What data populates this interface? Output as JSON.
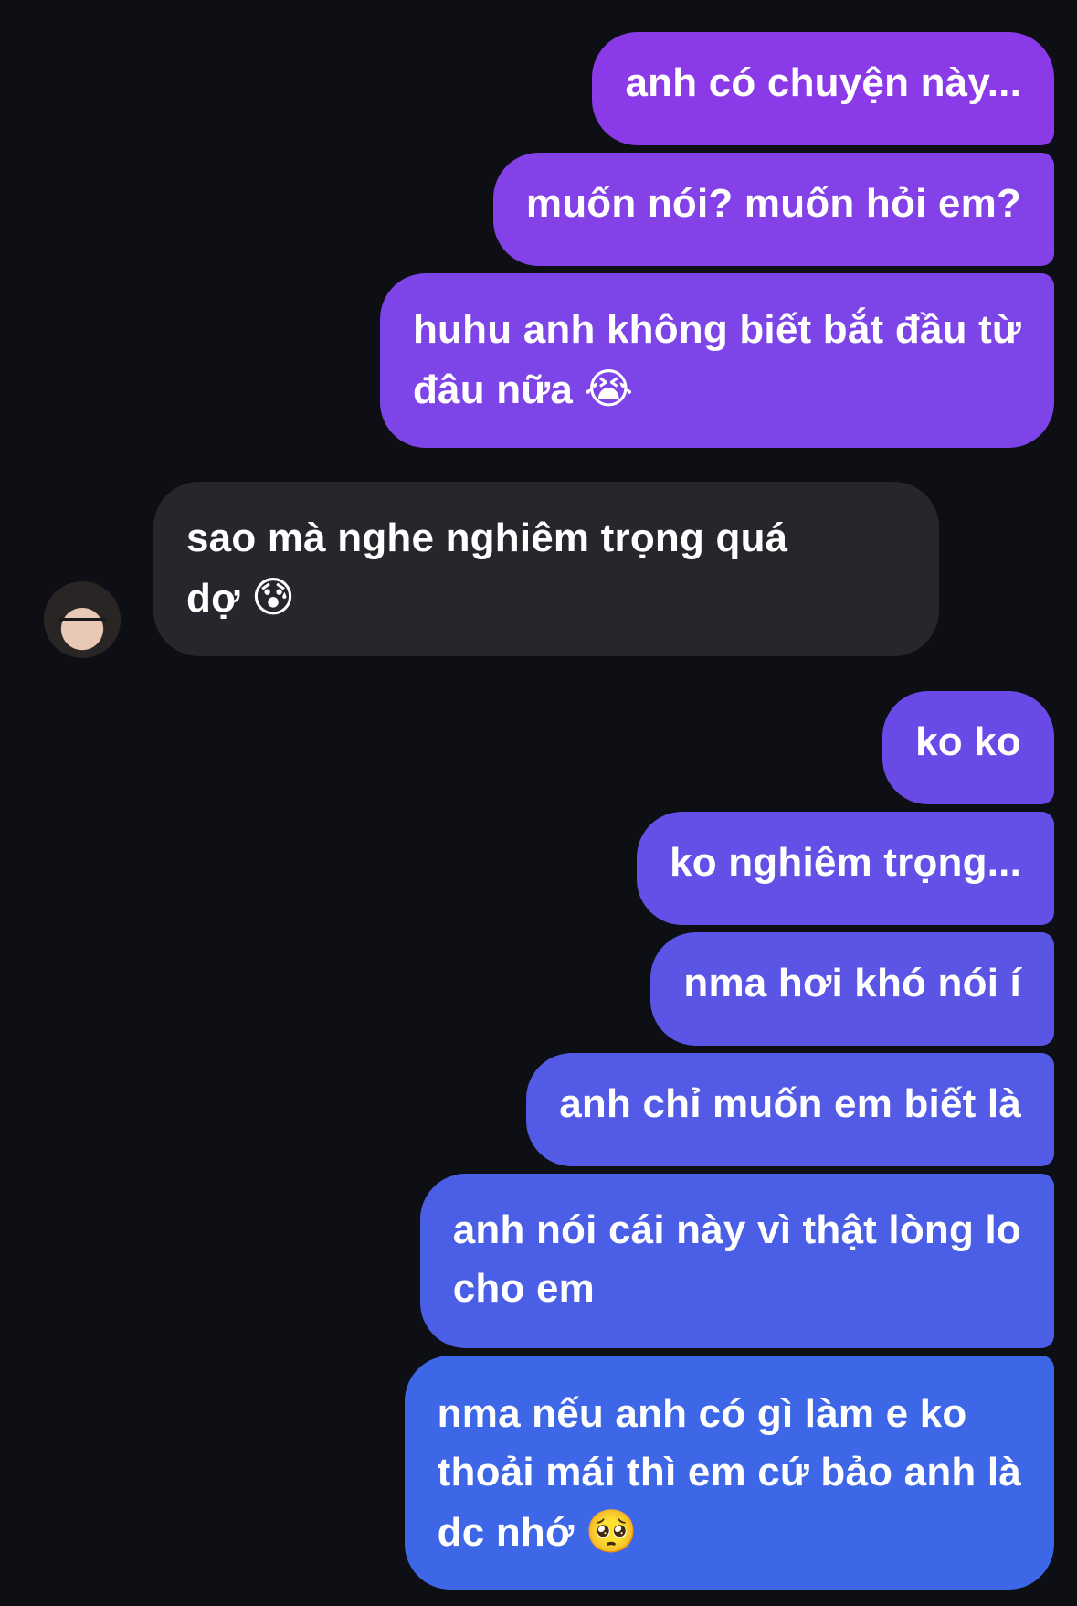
{
  "messages": [
    {
      "side": "out",
      "text": "anh có chuyện này..."
    },
    {
      "side": "out",
      "text": "muốn nói? muốn hỏi em?"
    },
    {
      "side": "out",
      "lines": [
        "huhu anh không biết bắt đầu từ",
        "đâu nữa"
      ],
      "emoji": "😭"
    },
    {
      "side": "in",
      "lines": [
        "sao mà nghe nghiêm trọng quá",
        "dợ"
      ],
      "emoji": "😰"
    },
    {
      "side": "out",
      "text": "ko ko"
    },
    {
      "side": "out",
      "text": "ko nghiêm trọng..."
    },
    {
      "side": "out",
      "text": "nma hơi khó nói í"
    },
    {
      "side": "out",
      "text": "anh chỉ muốn em biết là"
    },
    {
      "side": "out",
      "lines": [
        "anh nói cái này vì thật lòng lo",
        "cho em"
      ]
    },
    {
      "side": "out",
      "lines": [
        "nma nếu anh có gì làm e ko",
        "thoải mái thì em cứ bảo anh là",
        "dc nhớ"
      ],
      "emoji": "🥺"
    }
  ],
  "colors": {
    "background": "#0d0f14",
    "incoming_bubble": "#25272c",
    "outgoing_gradient_top": "#8a3ae6",
    "outgoing_gradient_mid": "#5a52e6",
    "outgoing_gradient_bottom": "#3a68e6",
    "text": "#ffffff"
  },
  "avatar": {
    "icon": "user-avatar-photo"
  }
}
